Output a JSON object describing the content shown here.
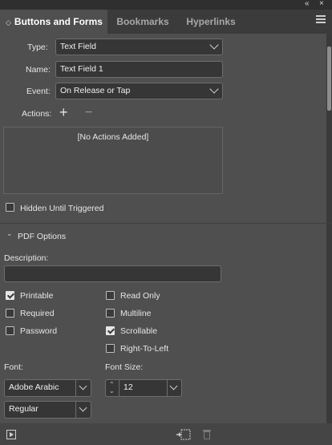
{
  "window": {
    "collapse_glyph": "«",
    "close_glyph": "×"
  },
  "tabs": [
    {
      "label": "Buttons and Forms",
      "active": true,
      "icon": "collapse-diamond-icon"
    },
    {
      "label": "Bookmarks",
      "active": false
    },
    {
      "label": "Hyperlinks",
      "active": false
    }
  ],
  "form": {
    "type_label": "Type:",
    "type_value": "Text Field",
    "name_label": "Name:",
    "name_value": "Text Field 1",
    "event_label": "Event:",
    "event_value": "On Release or Tap",
    "actions_label": "Actions:",
    "add_glyph": "+",
    "remove_glyph": "−",
    "actions_empty": "[No Actions Added]",
    "hidden_label": "Hidden Until Triggered",
    "hidden_checked": false
  },
  "pdf": {
    "section_label": "PDF Options",
    "description_label": "Description:",
    "description_value": "",
    "options": [
      {
        "label": "Printable",
        "checked": true
      },
      {
        "label": "Required",
        "checked": false
      },
      {
        "label": "Password",
        "checked": false
      },
      {
        "label": "Read Only",
        "checked": false
      },
      {
        "label": "Multiline",
        "checked": false
      },
      {
        "label": "Scrollable",
        "checked": true
      },
      {
        "label": "Right-To-Left",
        "checked": false
      }
    ],
    "font_label": "Font:",
    "font_value": "Adobe Arabic",
    "font_style_value": "Regular",
    "font_size_label": "Font Size:",
    "font_size_value": "12"
  },
  "footer": {
    "preview_icon": "preview-icon",
    "convert_icon": "convert-to-button-icon",
    "delete_icon": "trash-icon"
  }
}
